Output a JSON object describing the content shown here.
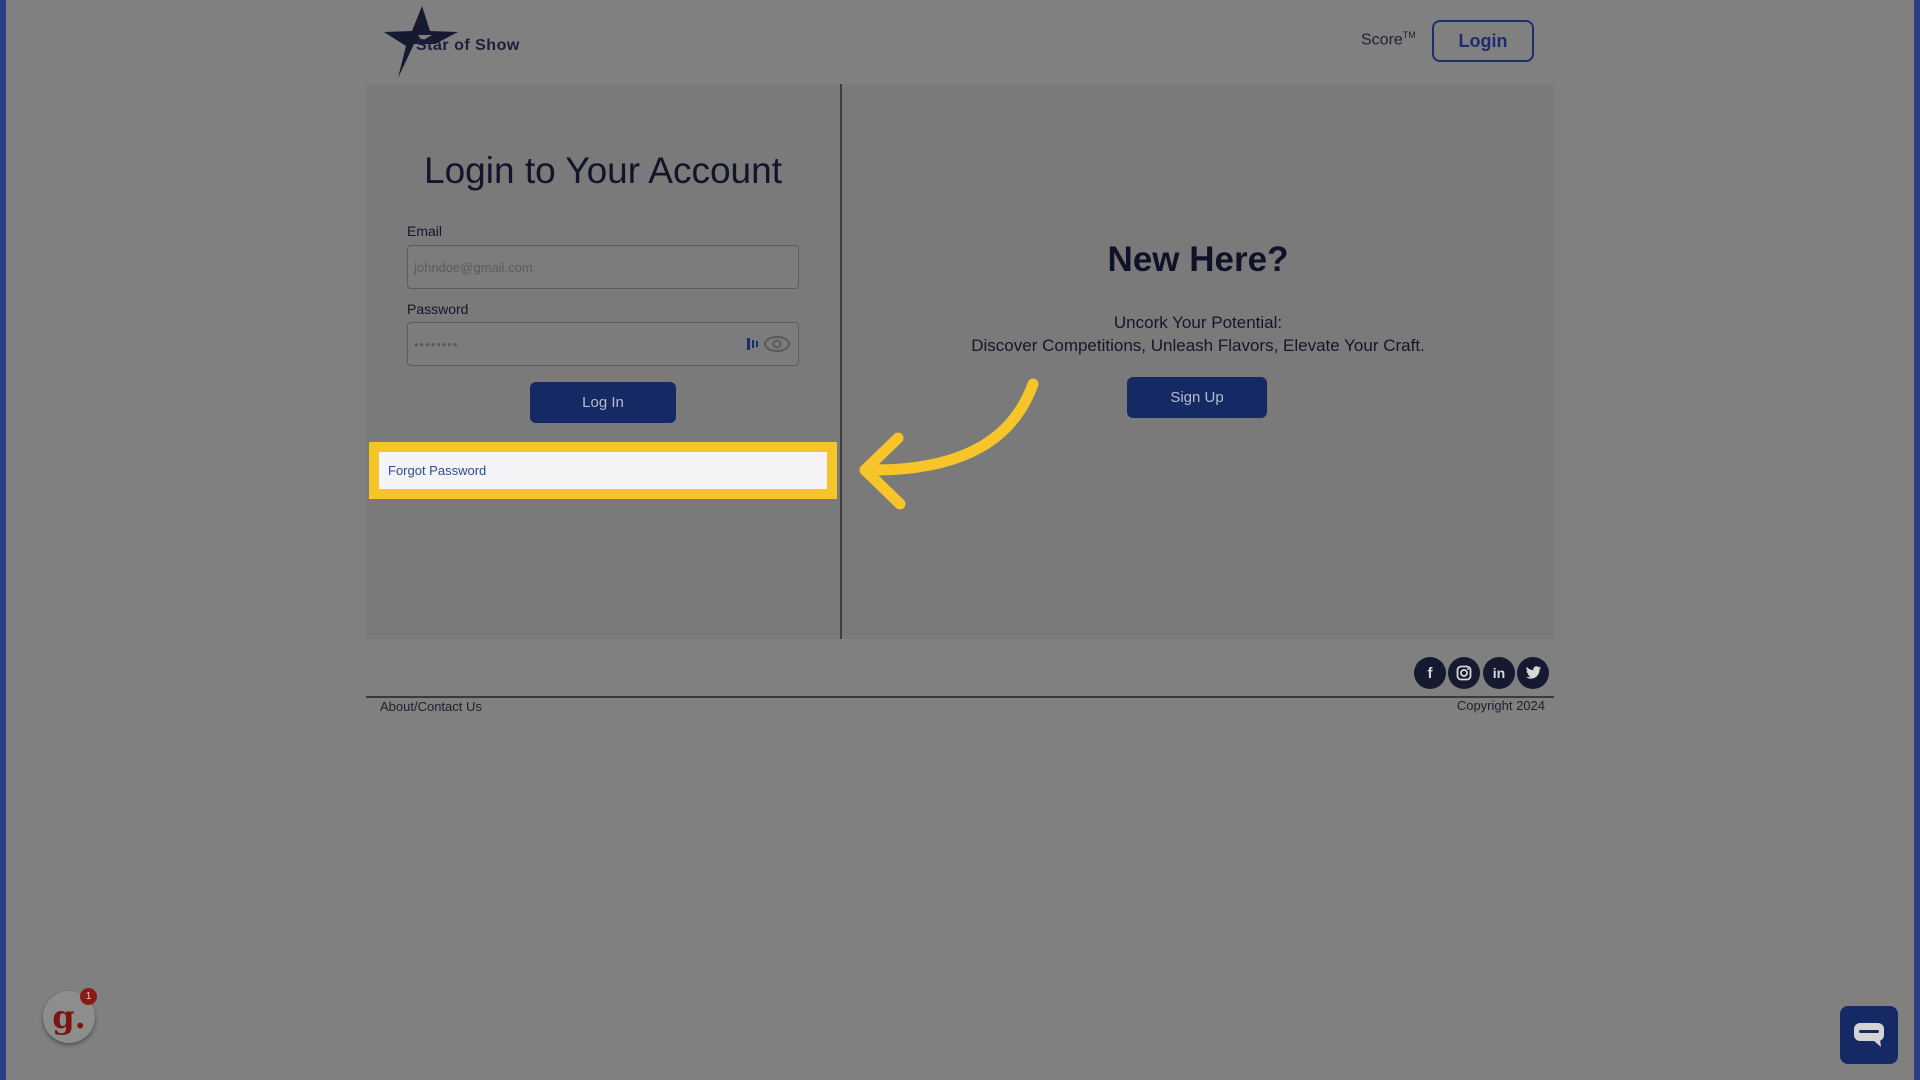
{
  "header": {
    "logo_text": "Star of Show",
    "score_label": "Score",
    "score_sup": "TM",
    "login_button": "Login"
  },
  "login": {
    "title": "Login to Your Account",
    "email_label": "Email",
    "email_placeholder": "johndoe@gmail.com",
    "password_label": "Password",
    "password_value": "••••••••",
    "submit_label": "Log In",
    "forgot_label": "Forgot Password"
  },
  "signup": {
    "title": "New Here?",
    "tagline_1": "Uncork Your Potential:",
    "tagline_2": "Discover Competitions, Unleash Flavors, Elevate Your Craft.",
    "button": "Sign Up"
  },
  "footer": {
    "about_link": "About/Contact Us",
    "copyright": "Copyright 2024",
    "social_icons": [
      "facebook-icon",
      "instagram-icon",
      "linkedin-icon",
      "twitter-icon"
    ]
  },
  "widgets": {
    "g_letter": "g.",
    "g_badge_count": "1"
  },
  "colors": {
    "primary": "#152a64",
    "highlight": "#f7c52a",
    "overlay_bg": "#808080"
  }
}
